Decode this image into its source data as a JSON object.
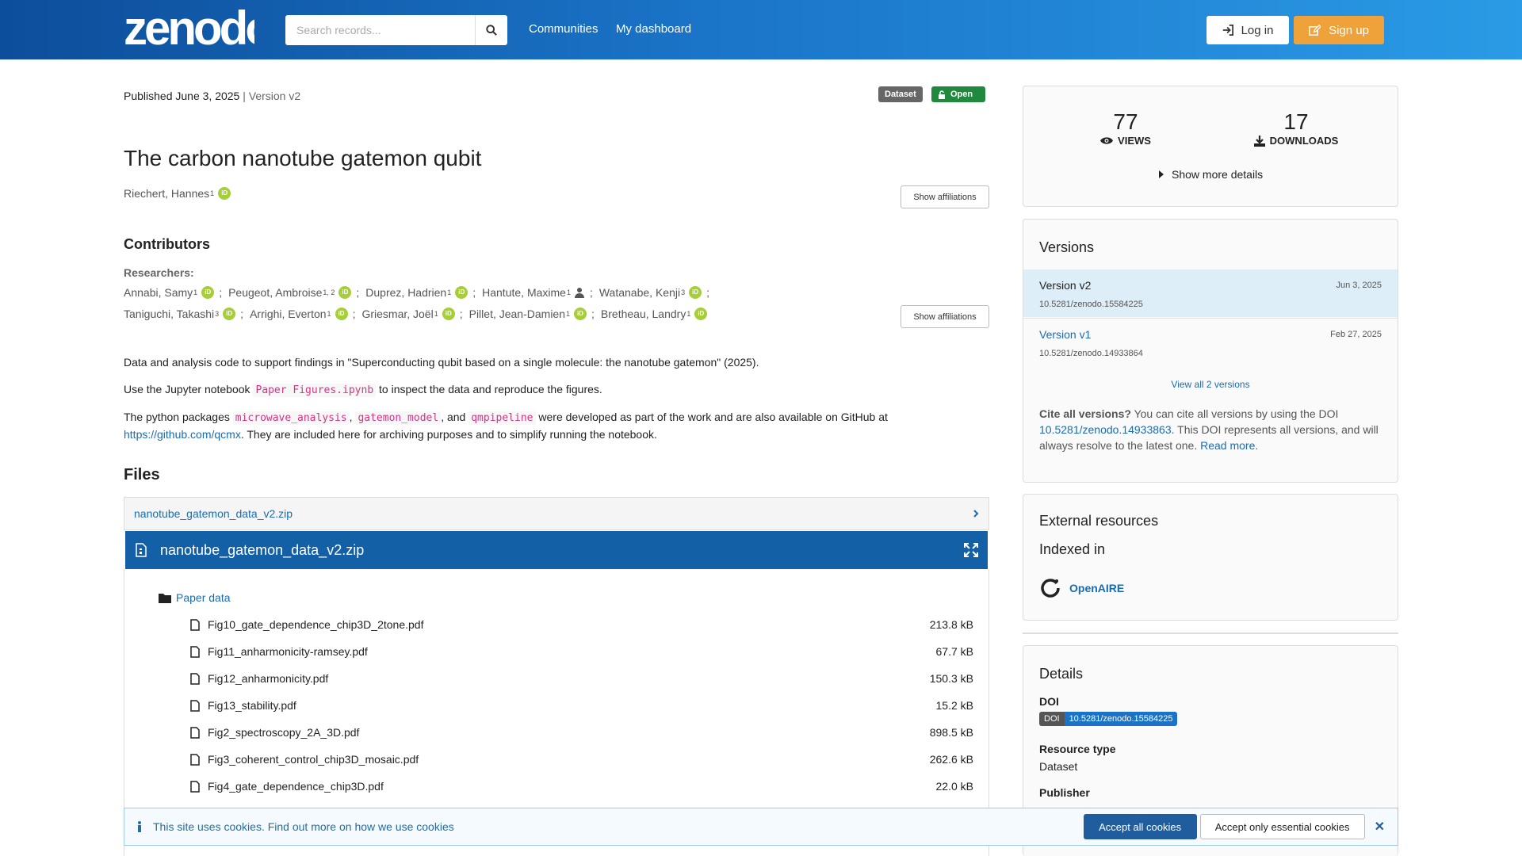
{
  "header": {
    "logo_text": "zenodo",
    "search_placeholder": "Search records...",
    "nav": [
      "Communities",
      "My dashboard"
    ],
    "login_label": "Log in",
    "signup_label": "Sign up"
  },
  "record": {
    "published": "Published June 3, 2025",
    "version_sep": " | Version v2",
    "badge_type": "Dataset",
    "badge_access": "Open",
    "title": "The carbon nanotube gatemon qubit",
    "creator": {
      "name": "Riechert, Hannes",
      "sup": "1"
    },
    "show_affiliations": "Show affiliations",
    "contributors_heading": "Contributors",
    "researchers_label": "Researchers:",
    "contributors_line1": [
      {
        "name": "Annabi, Samy",
        "sup": "1"
      },
      {
        "name": "Peugeot, Ambroise",
        "sup": "1, 2"
      },
      {
        "name": "Duprez, Hadrien",
        "sup": "1"
      },
      {
        "name": "Hantute, Maxime",
        "sup": "1"
      },
      {
        "name": "Watanabe, Kenji",
        "sup": "3"
      }
    ],
    "contributors_line2": [
      {
        "name": "Taniguchi, Takashi",
        "sup": "3"
      },
      {
        "name": "Arrighi, Everton",
        "sup": "1"
      },
      {
        "name": "Griesmar, Joël",
        "sup": "1"
      },
      {
        "name": "Pillet, Jean-Damien",
        "sup": "1"
      },
      {
        "name": "Bretheau, Landry",
        "sup": "1"
      }
    ],
    "description": {
      "p1": "Data and analysis code to support findings in \"Superconducting qubit based on a single molecule: the nanotube gatemon\" (2025).",
      "p2_before": "Use the Jupyter notebook ",
      "p2_code": "Paper Figures.ipynb",
      "p2_after": " to inspect the data and reproduce the figures.",
      "p3_a": "The python packages ",
      "p3_code1": "microwave_analysis",
      "p3_b": ", ",
      "p3_code2": "gatemon_model",
      "p3_c": ", and ",
      "p3_code3": "qmpipeline",
      "p3_d": " were developed as part of the work and are also available on GitHub at",
      "p3_link": "https://github.com/qcmx",
      "p3_e": ". They are included here for archiving purposes and to simplify running the notebook."
    },
    "files_heading": "Files",
    "archive_name": "nanotube_gatemon_data_v2.zip",
    "folder": "Paper data",
    "files": [
      {
        "name": "Fig10_gate_dependence_chip3D_2tone.pdf",
        "size": "213.8 kB"
      },
      {
        "name": "Fig11_anharmonicity-ramsey.pdf",
        "size": "67.7 kB"
      },
      {
        "name": "Fig12_anharmonicity.pdf",
        "size": "150.3 kB"
      },
      {
        "name": "Fig13_stability.pdf",
        "size": "15.2 kB"
      },
      {
        "name": "Fig2_spectroscopy_2A_3D.pdf",
        "size": "898.5 kB"
      },
      {
        "name": "Fig3_coherent_control_chip3D_mosaic.pdf",
        "size": "262.6 kB"
      },
      {
        "name": "Fig4_gate_dependence_chip3D.pdf",
        "size": "22.0 kB"
      }
    ]
  },
  "sidebar": {
    "views": "77",
    "views_label": "VIEWS",
    "downloads": "17",
    "downloads_label": "DOWNLOADS",
    "show_more": "Show more details",
    "versions_heading": "Versions",
    "versions": [
      {
        "name": "Version v2",
        "doi": "10.5281/zenodo.15584225",
        "date": "Jun 3, 2025"
      },
      {
        "name": "Version v1",
        "doi": "10.5281/zenodo.14933864",
        "date": "Feb 27, 2025"
      }
    ],
    "view_all": "View all 2 versions",
    "cite_bold": "Cite all versions?",
    "cite_text": " You can cite all versions by using the DOI ",
    "cite_doi": "10.5281/zenodo.14933863",
    "cite_text2": ". This DOI represents all versions, and will always resolve to the latest one. ",
    "read_more": "Read more.",
    "external_heading": "External resources",
    "indexed_heading": "Indexed in",
    "openaire": "OpenAIRE",
    "details_heading": "Details",
    "doi_label": "DOI",
    "doi_badge_key": "DOI",
    "doi_badge_value": "10.5281/zenodo.15584225",
    "resource_type_label": "Resource type",
    "resource_type": "Dataset",
    "publisher_label": "Publisher"
  },
  "cookie": {
    "message": "This site uses cookies. Find out more on ",
    "link": "how we use cookies",
    "accept_all": "Accept all cookies",
    "accept_essential": "Accept only essential cookies"
  },
  "colors": {
    "header_start": "#0d4e9a",
    "header_end": "#2a9be6",
    "open_badge": "#21893d",
    "signup": "#f0a23a",
    "link": "#1a6bb0"
  }
}
